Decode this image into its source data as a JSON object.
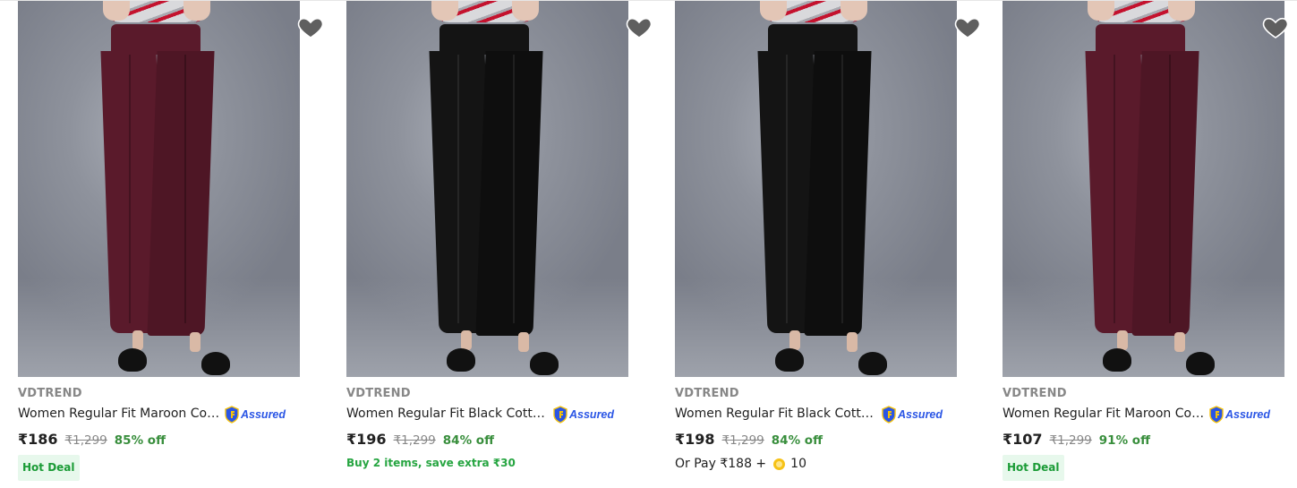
{
  "products": [
    {
      "brand": "VDTREND",
      "title": "Women Regular Fit Maroon Cotton Blend Trousers",
      "assured_label": "Assured",
      "price": "₹186",
      "mrp": "₹1,299",
      "discount": "85% off",
      "offer": "Hot Deal",
      "pants_color": "#5a1a2b",
      "image_icon": "trousers-photo"
    },
    {
      "brand": "VDTREND",
      "title": "Women Regular Fit Black Cotton Blend Trousers",
      "assured_label": "Assured",
      "price": "₹196",
      "mrp": "₹1,299",
      "discount": "84% off",
      "offer": "Buy 2 items, save extra ₹30",
      "pants_color": "#141414",
      "image_icon": "trousers-photo"
    },
    {
      "brand": "VDTREND",
      "title": "Women Regular Fit Black Cotton Blend Trousers",
      "assured_label": "Assured",
      "price": "₹198",
      "mrp": "₹1,299",
      "discount": "84% off",
      "orpay_label": "Or Pay ₹188 +",
      "supercoins": "10",
      "pants_color": "#141414",
      "image_icon": "trousers-photo"
    },
    {
      "brand": "VDTREND",
      "title": "Women Regular Fit Maroon Cotton Blend Trousers",
      "assured_label": "Assured",
      "price": "₹107",
      "mrp": "₹1,299",
      "discount": "91% off",
      "offer": "Hot Deal",
      "pants_color": "#5a1a2b",
      "image_icon": "trousers-photo"
    }
  ],
  "icons": {
    "wishlist": "heart-icon",
    "assured": "shield-icon",
    "coin": "supercoin-icon"
  },
  "colors": {
    "price_off": "#388e3c",
    "assured_blue": "#2a55e5",
    "hot_deal_bg": "#e7f8ec"
  }
}
